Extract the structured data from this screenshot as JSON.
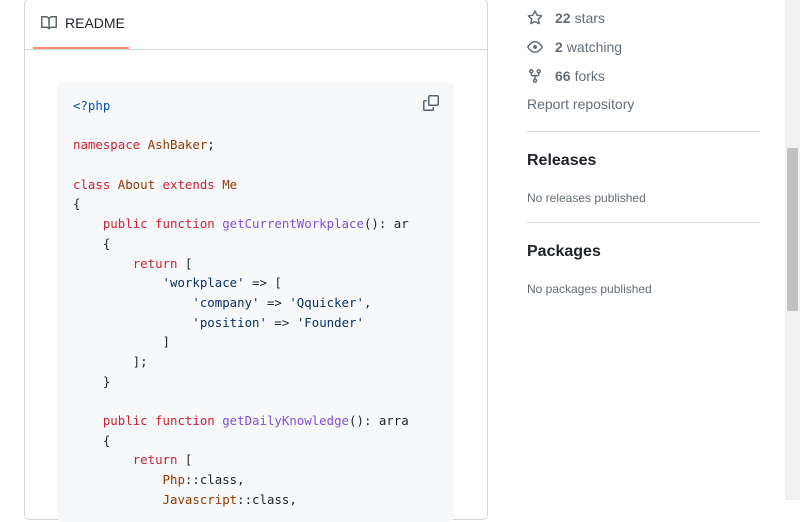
{
  "readme": {
    "tab_label": "README",
    "tab_icon": "book-icon",
    "copy_icon": "copy-icon",
    "code": [
      [
        {
          "c": "m",
          "v": "<?php"
        }
      ],
      [],
      [
        {
          "c": "k",
          "v": "namespace "
        },
        {
          "c": "t",
          "v": "AshBaker"
        },
        {
          "c": "p",
          "v": ";"
        }
      ],
      [],
      [
        {
          "c": "k",
          "v": "class "
        },
        {
          "c": "t",
          "v": "About "
        },
        {
          "c": "k",
          "v": "extends "
        },
        {
          "c": "t",
          "v": "Me"
        }
      ],
      [
        {
          "c": "p",
          "v": "{"
        }
      ],
      [
        {
          "c": "p",
          "v": "    "
        },
        {
          "c": "k",
          "v": "public function "
        },
        {
          "c": "f",
          "v": "getCurrentWorkplace"
        },
        {
          "c": "p",
          "v": "(): ar"
        }
      ],
      [
        {
          "c": "p",
          "v": "    {"
        }
      ],
      [
        {
          "c": "p",
          "v": "        "
        },
        {
          "c": "k",
          "v": "return "
        },
        {
          "c": "p",
          "v": "["
        }
      ],
      [
        {
          "c": "p",
          "v": "            "
        },
        {
          "c": "s",
          "v": "'workplace'"
        },
        {
          "c": "p",
          "v": " => ["
        }
      ],
      [
        {
          "c": "p",
          "v": "                "
        },
        {
          "c": "s",
          "v": "'company'"
        },
        {
          "c": "p",
          "v": " => "
        },
        {
          "c": "s",
          "v": "'Qquicker'"
        },
        {
          "c": "p",
          "v": ","
        }
      ],
      [
        {
          "c": "p",
          "v": "                "
        },
        {
          "c": "s",
          "v": "'position'"
        },
        {
          "c": "p",
          "v": " => "
        },
        {
          "c": "s",
          "v": "'Founder'"
        }
      ],
      [
        {
          "c": "p",
          "v": "            ]"
        }
      ],
      [
        {
          "c": "p",
          "v": "        ];"
        }
      ],
      [
        {
          "c": "p",
          "v": "    }"
        }
      ],
      [],
      [
        {
          "c": "p",
          "v": "    "
        },
        {
          "c": "k",
          "v": "public function "
        },
        {
          "c": "f",
          "v": "getDailyKnowledge"
        },
        {
          "c": "p",
          "v": "(): arra"
        }
      ],
      [
        {
          "c": "p",
          "v": "    {"
        }
      ],
      [
        {
          "c": "p",
          "v": "        "
        },
        {
          "c": "k",
          "v": "return "
        },
        {
          "c": "p",
          "v": "["
        }
      ],
      [
        {
          "c": "p",
          "v": "            "
        },
        {
          "c": "t",
          "v": "Php"
        },
        {
          "c": "p",
          "v": "::class,"
        }
      ],
      [
        {
          "c": "p",
          "v": "            "
        },
        {
          "c": "t",
          "v": "Javascript"
        },
        {
          "c": "p",
          "v": "::class,"
        }
      ]
    ]
  },
  "sidebar": {
    "stars_count": "22",
    "stars_label": "stars",
    "watching_count": "2",
    "watching_label": "watching",
    "forks_count": "66",
    "forks_label": "forks",
    "report_label": "Report repository",
    "releases_title": "Releases",
    "releases_empty": "No releases published",
    "packages_title": "Packages",
    "packages_empty": "No packages published"
  },
  "colors": {
    "tab_underline": "#fd8c73",
    "muted_text": "#656d76",
    "code_bg": "#f6f8fa"
  }
}
